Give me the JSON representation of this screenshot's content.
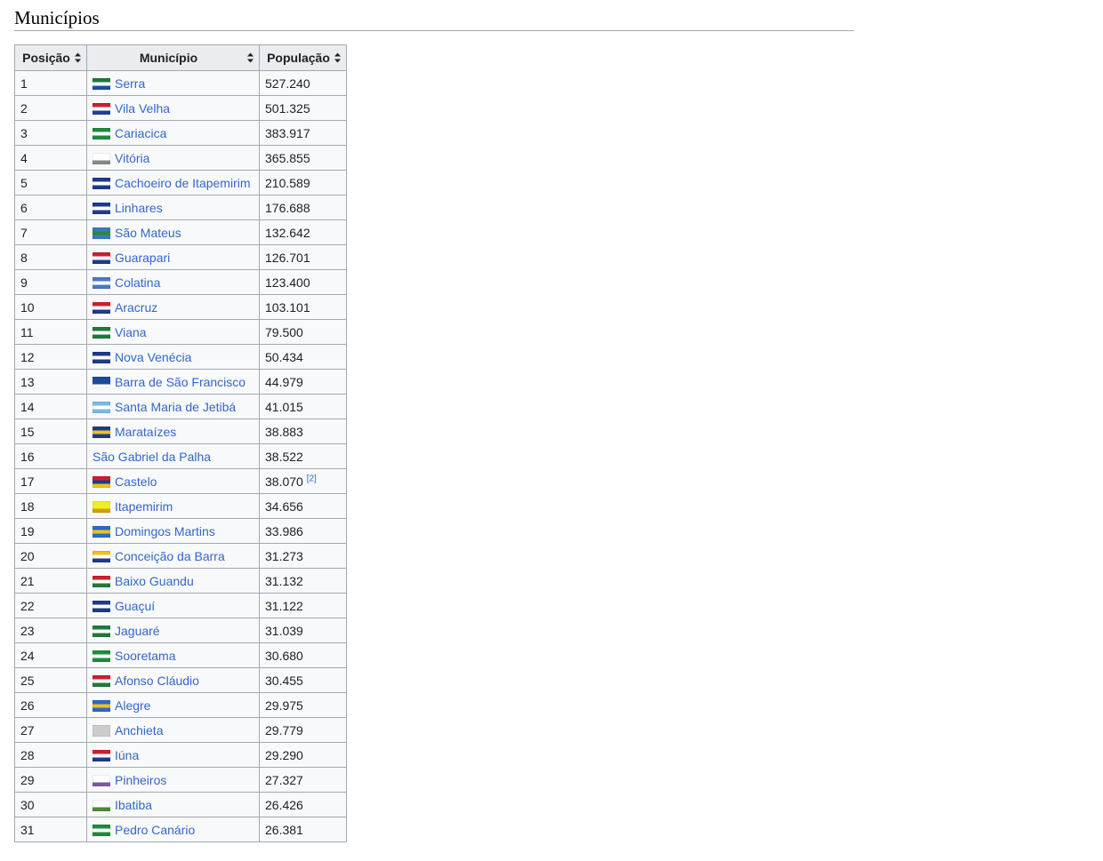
{
  "heading": "Municípios",
  "table": {
    "headers": {
      "position": "Posição",
      "municipality": "Município",
      "population": "População"
    },
    "rows": [
      {
        "pos": "1",
        "name": "Serra",
        "pop": "527.240",
        "flag": [
          "#1a7a3c",
          "#ffffff",
          "#1a4fa0"
        ]
      },
      {
        "pos": "2",
        "name": "Vila Velha",
        "pop": "501.325",
        "flag": [
          "#cc1f2f",
          "#ffffff",
          "#1f3f9c"
        ]
      },
      {
        "pos": "3",
        "name": "Cariacica",
        "pop": "383.917",
        "flag": [
          "#1f8a3a",
          "#ffffff",
          "#1f8a3a"
        ]
      },
      {
        "pos": "4",
        "name": "Vitória",
        "pop": "365.855",
        "flag": [
          "#ffffff",
          "#ffffff",
          "#888888"
        ]
      },
      {
        "pos": "5",
        "name": "Cachoeiro de Itapemirim",
        "pop": "210.589",
        "flag": [
          "#1f3a8a",
          "#ffffff",
          "#1f3a8a"
        ]
      },
      {
        "pos": "6",
        "name": "Linhares",
        "pop": "176.688",
        "flag": [
          "#1f3a8a",
          "#ffffff",
          "#1f3a8a"
        ]
      },
      {
        "pos": "7",
        "name": "São Mateus",
        "pop": "132.642",
        "flag": [
          "#3a7ac0",
          "#2a8a3a",
          "#3a7ac0"
        ]
      },
      {
        "pos": "8",
        "name": "Guarapari",
        "pop": "126.701",
        "flag": [
          "#cc1f2f",
          "#ffffff",
          "#1f3a8a"
        ]
      },
      {
        "pos": "9",
        "name": "Colatina",
        "pop": "123.400",
        "flag": [
          "#4a7ac0",
          "#ffffff",
          "#4a7ac0"
        ]
      },
      {
        "pos": "10",
        "name": "Aracruz",
        "pop": "103.101",
        "flag": [
          "#cc1f2f",
          "#ffffff",
          "#1f3a8a"
        ]
      },
      {
        "pos": "11",
        "name": "Viana",
        "pop": "79.500",
        "flag": [
          "#1f7a3a",
          "#ffffff",
          "#1f7a3a"
        ]
      },
      {
        "pos": "12",
        "name": "Nova Venécia",
        "pop": "50.434",
        "flag": [
          "#1f3a8a",
          "#ffffff",
          "#1f3a8a"
        ]
      },
      {
        "pos": "13",
        "name": "Barra de São Francisco",
        "pop": "44.979",
        "flag": [
          "#1f4a9a",
          "#1f4a9a",
          "#ffffff"
        ]
      },
      {
        "pos": "14",
        "name": "Santa Maria de Jetibá",
        "pop": "41.015",
        "flag": [
          "#7ab8e8",
          "#ffffff",
          "#7ab8e8"
        ]
      },
      {
        "pos": "15",
        "name": "Marataízes",
        "pop": "38.883",
        "flag": [
          "#1f3a8a",
          "#f0c020",
          "#1f3a8a"
        ]
      },
      {
        "pos": "16",
        "name": "São Gabriel da Palha",
        "pop": "38.522",
        "flag": null
      },
      {
        "pos": "17",
        "name": "Castelo",
        "pop": "38.070",
        "ref": "[2]",
        "flag": [
          "#cc1f2f",
          "#1f3a8a",
          "#f0c020"
        ]
      },
      {
        "pos": "18",
        "name": "Itapemirim",
        "pop": "34.656",
        "flag": [
          "#f0f020",
          "#f0f020",
          "#d0a000"
        ]
      },
      {
        "pos": "19",
        "name": "Domingos Martins",
        "pop": "33.986",
        "flag": [
          "#2a6ac0",
          "#f0c020",
          "#2a6ac0"
        ]
      },
      {
        "pos": "20",
        "name": "Conceição da Barra",
        "pop": "31.273",
        "flag": [
          "#f0c020",
          "#ffffff",
          "#1f3a8a"
        ]
      },
      {
        "pos": "21",
        "name": "Baixo Guandu",
        "pop": "31.132",
        "flag": [
          "#cc1f2f",
          "#ffffff",
          "#1f7a3a"
        ]
      },
      {
        "pos": "22",
        "name": "Guaçuí",
        "pop": "31.122",
        "flag": [
          "#1f3a8a",
          "#ffffff",
          "#1f3a8a"
        ]
      },
      {
        "pos": "23",
        "name": "Jaguaré",
        "pop": "31.039",
        "flag": [
          "#1f7a3a",
          "#ffffff",
          "#1f7a3a"
        ]
      },
      {
        "pos": "24",
        "name": "Sooretama",
        "pop": "30.680",
        "flag": [
          "#1f8a3a",
          "#ffffff",
          "#1f8a3a"
        ]
      },
      {
        "pos": "25",
        "name": "Afonso Cláudio",
        "pop": "30.455",
        "flag": [
          "#cc1f2f",
          "#ffffff",
          "#1f7a3a"
        ]
      },
      {
        "pos": "26",
        "name": "Alegre",
        "pop": "29.975",
        "flag": [
          "#2a6ac0",
          "#f0c020",
          "#2a6ac0"
        ]
      },
      {
        "pos": "27",
        "name": "Anchieta",
        "pop": "29.779",
        "flag": [
          "#cccccc",
          "#cccccc",
          "#cccccc"
        ]
      },
      {
        "pos": "28",
        "name": "Iúna",
        "pop": "29.290",
        "flag": [
          "#cc1f2f",
          "#ffffff",
          "#1f3a8a"
        ]
      },
      {
        "pos": "29",
        "name": "Pinheiros",
        "pop": "27.327",
        "flag": [
          "#ffffff",
          "#ffffff",
          "#7a5aa0"
        ]
      },
      {
        "pos": "30",
        "name": "Ibatiba",
        "pop": "26.426",
        "flag": [
          "#ffffff",
          "#ffffff",
          "#4a8a3a"
        ]
      },
      {
        "pos": "31",
        "name": "Pedro Canário",
        "pop": "26.381",
        "flag": [
          "#1f8a3a",
          "#ffffff",
          "#1f8a3a"
        ]
      }
    ]
  }
}
